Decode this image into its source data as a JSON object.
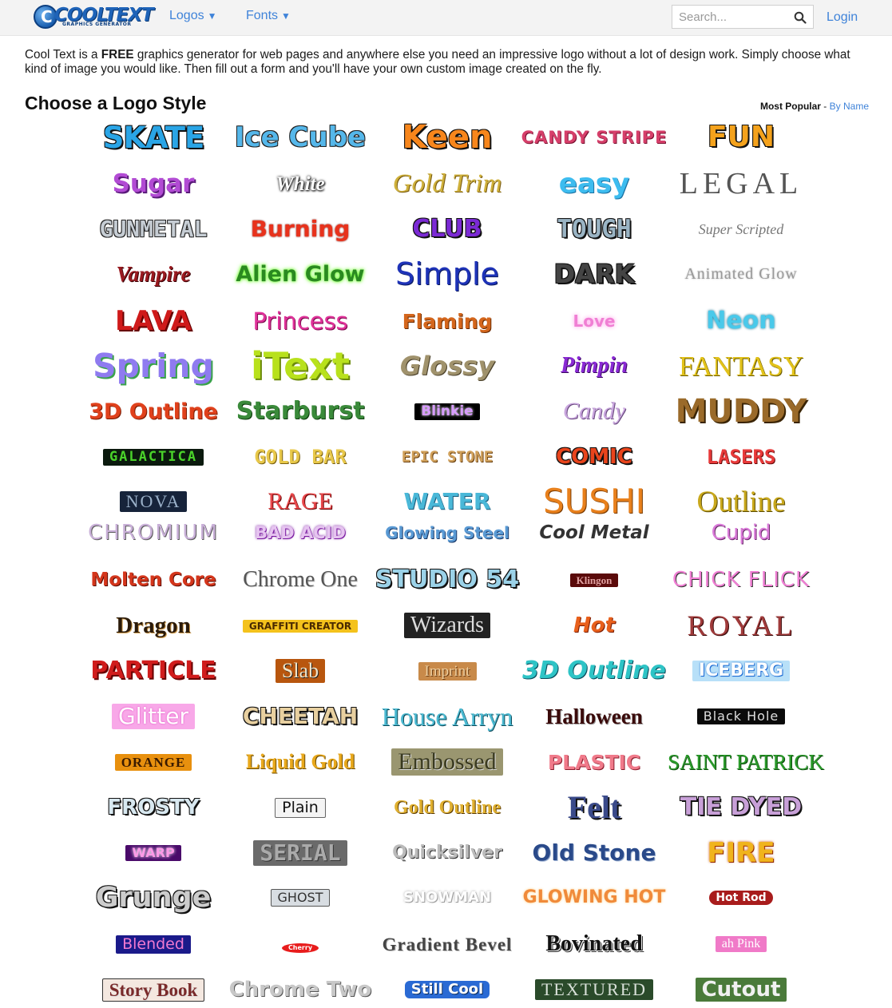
{
  "header": {
    "logo_text": "COOLTEXT",
    "logo_sub": "GRAPHICS GENERATOR",
    "nav": [
      {
        "label": "Logos",
        "caret": "▼"
      },
      {
        "label": "Fonts",
        "caret": "▼"
      }
    ],
    "search_placeholder": "Search...",
    "login_label": "Login"
  },
  "intro": {
    "prefix": "Cool Text is a ",
    "bold": "FREE",
    "suffix": " graphics generator for web pages and anywhere else you need an impressive logo without a lot of design work.  Simply choose what kind of image you would like. Then fill out a form and you'll have your own custom image created on the fly."
  },
  "section": {
    "title": "Choose a Logo Style",
    "sort_active": "Most Popular",
    "sort_separator": " - ",
    "sort_link": "By Name"
  },
  "styles": [
    "SKATE",
    "Ice Cube",
    "Keen",
    "CANDY STRIPE",
    "FUN",
    "Sugar",
    "White",
    "Gold Trim",
    "easy",
    "LEGAL",
    "GUNMETAL",
    "Burning",
    "CLUB",
    "TOUGH",
    "Super Scripted",
    "Vampire",
    "Alien Glow",
    "Simple",
    "DARK",
    "Animated Glow",
    "LAVA",
    "Princess",
    "Flaming",
    "Love",
    "Neon",
    "Spring",
    "iText",
    "Glossy",
    "Pimpin",
    "FANTASY",
    "3D Outline",
    "Starburst",
    "Blinkie",
    "Candy",
    "MUDDY",
    "GALACTICA",
    "GOLD BAR",
    "EPIC STONE",
    "COMIC",
    "LASERS",
    "NOVA",
    "RAGE",
    "WATER",
    "SUSHI",
    "Outline",
    "CHROMIUM",
    "BAD ACID",
    "Glowing Steel",
    "Cool Metal",
    "Cupid",
    "Molten Core",
    "Chrome One",
    "STUDIO 54",
    "Klingon",
    "CHICK FLICK",
    "Dragon",
    "GRAFFITI CREATOR",
    "Wizards",
    "Hot",
    "ROYAL",
    "PARTICLE",
    "Slab",
    "Imprint",
    "3D Outline",
    "ICEBERG",
    "Glitter",
    "CHEETAH",
    "House Arryn",
    "Halloween",
    "Black Hole",
    "ORANGE",
    "Liquid Gold",
    "Embossed",
    "PLASTIC",
    "SAINT PATRICK",
    "FROSTY",
    "Plain",
    "Gold Outline",
    "Felt",
    "TIE DYED",
    "WARP",
    "SERIAL",
    "Quicksilver",
    "Old Stone",
    "FIRE",
    "Grunge",
    "GHOST",
    "SNOWMAN",
    "GLOWING HOT",
    "Hot Rod",
    "Blended",
    "Cherry",
    "Gradient Bevel",
    "Bovinated",
    "ah Pink",
    "Story Book",
    "Chrome Two",
    "Still Cool",
    "TEXTURED",
    "Cutout"
  ]
}
